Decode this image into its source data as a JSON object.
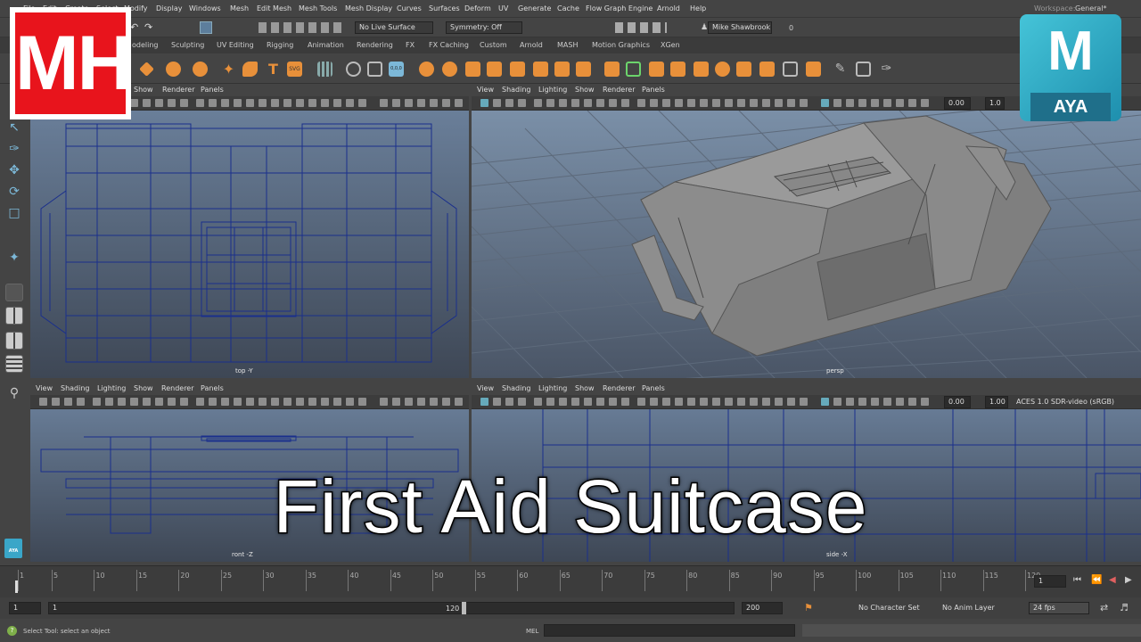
{
  "menubar": {
    "items": [
      "File",
      "Edit",
      "Create",
      "Select",
      "Modify",
      "Display",
      "Windows",
      "Mesh",
      "Edit Mesh",
      "Mesh Tools",
      "Mesh Display",
      "Curves",
      "Surfaces",
      "Deform",
      "UV",
      "Generate",
      "Cache",
      "Flow Graph Engine",
      "Arnold",
      "Help"
    ],
    "workspace_label": "Workspace:",
    "workspace_value": "General*"
  },
  "statusline": {
    "live_surface": "No Live Surface",
    "symmetry": "Symmetry: Off",
    "user": "Mike Shawbrook",
    "count": "0"
  },
  "shelf": {
    "tabs": [
      "odeling",
      "Sculpting",
      "UV Editing",
      "Rigging",
      "Animation",
      "Rendering",
      "FX",
      "FX Caching",
      "Custom",
      "Arnold",
      "MASH",
      "Motion Graphics",
      "XGen"
    ]
  },
  "viewports": {
    "menu": [
      "View",
      "Shading",
      "Lighting",
      "Show",
      "Renderer",
      "Panels"
    ],
    "top": {
      "menu_visible": [
        "Show",
        "Renderer",
        "Panels"
      ],
      "label": "top -Y"
    },
    "persp": {
      "label": "persp",
      "exposure": "0.00",
      "gamma": "1.0"
    },
    "front": {
      "label": "ront -Z"
    },
    "side": {
      "label": "side -X",
      "exposure": "0.00",
      "gamma": "1.00",
      "colorspace": "ACES 1.0 SDR-video (sRGB)"
    }
  },
  "timeslider": {
    "ticks": [
      "1",
      "5",
      "10",
      "15",
      "20",
      "25",
      "30",
      "35",
      "40",
      "45",
      "50",
      "55",
      "60",
      "65",
      "70",
      "75",
      "80",
      "85",
      "90",
      "95",
      "100",
      "105",
      "110",
      "115",
      "120"
    ],
    "current_frame": "1"
  },
  "range": {
    "start": "1",
    "inner_start": "1",
    "inner_end": "120",
    "end": "200",
    "character_set": "No Character Set",
    "anim_layer": "No Anim Layer",
    "fps": "24 fps"
  },
  "cmdline": {
    "help_text": "Select Tool: select an object",
    "mel_label": "MEL"
  },
  "branding": {
    "mh_logo": "MH",
    "maya_letter": "M",
    "maya_word": "AYA",
    "small_badge": "AYA"
  },
  "title": "First Aid Suitcase",
  "colors": {
    "accent": "#45c4d8",
    "logo_red": "#e8141c",
    "wire_blue": "#1a2f8c"
  }
}
